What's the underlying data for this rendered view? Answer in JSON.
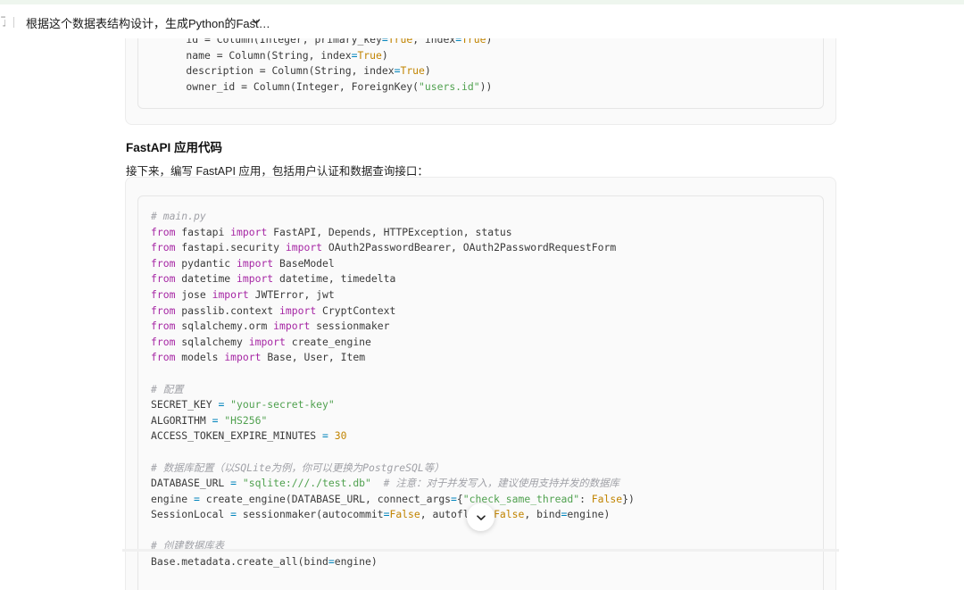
{
  "header": {
    "left_glyph": "了",
    "conversation_title": "根据这个数据表结构设计，生成Python的Fast…"
  },
  "code_block_1": {
    "lines": [
      [
        [
          "plain",
          "    id = Column(Integer, primary_key"
        ],
        [
          "op",
          "="
        ],
        [
          "bool",
          "True"
        ],
        [
          "plain",
          ", index"
        ],
        [
          "op",
          "="
        ],
        [
          "bool",
          "True"
        ],
        [
          "plain",
          ")"
        ]
      ],
      [
        [
          "plain",
          "    name = Column(String, index"
        ],
        [
          "op",
          "="
        ],
        [
          "bool",
          "True"
        ],
        [
          "plain",
          ")"
        ]
      ],
      [
        [
          "plain",
          "    description = Column(String, index"
        ],
        [
          "op",
          "="
        ],
        [
          "bool",
          "True"
        ],
        [
          "plain",
          ")"
        ]
      ],
      [
        [
          "plain",
          "    owner_id = Column(Integer, ForeignKey("
        ],
        [
          "str",
          "\"users.id\""
        ],
        [
          "plain",
          "))"
        ]
      ]
    ]
  },
  "section": {
    "heading": "FastAPI 应用代码",
    "paragraph": "接下来，编写 FastAPI 应用，包括用户认证和数据查询接口："
  },
  "code_block_2": {
    "lines": [
      [
        [
          "cm",
          "# main.py"
        ]
      ],
      [
        [
          "kw",
          "from"
        ],
        [
          "plain",
          " fastapi "
        ],
        [
          "kw",
          "import"
        ],
        [
          "plain",
          " FastAPI, Depends, HTTPException, status"
        ]
      ],
      [
        [
          "kw",
          "from"
        ],
        [
          "plain",
          " fastapi.security "
        ],
        [
          "kw",
          "import"
        ],
        [
          "plain",
          " OAuth2PasswordBearer, OAuth2PasswordRequestForm"
        ]
      ],
      [
        [
          "kw",
          "from"
        ],
        [
          "plain",
          " pydantic "
        ],
        [
          "kw",
          "import"
        ],
        [
          "plain",
          " BaseModel"
        ]
      ],
      [
        [
          "kw",
          "from"
        ],
        [
          "plain",
          " datetime "
        ],
        [
          "kw",
          "import"
        ],
        [
          "plain",
          " datetime, timedelta"
        ]
      ],
      [
        [
          "kw",
          "from"
        ],
        [
          "plain",
          " jose "
        ],
        [
          "kw",
          "import"
        ],
        [
          "plain",
          " JWTError, jwt"
        ]
      ],
      [
        [
          "kw",
          "from"
        ],
        [
          "plain",
          " passlib.context "
        ],
        [
          "kw",
          "import"
        ],
        [
          "plain",
          " CryptContext"
        ]
      ],
      [
        [
          "kw",
          "from"
        ],
        [
          "plain",
          " sqlalchemy.orm "
        ],
        [
          "kw",
          "import"
        ],
        [
          "plain",
          " sessionmaker"
        ]
      ],
      [
        [
          "kw",
          "from"
        ],
        [
          "plain",
          " sqlalchemy "
        ],
        [
          "kw",
          "import"
        ],
        [
          "plain",
          " create_engine"
        ]
      ],
      [
        [
          "kw",
          "from"
        ],
        [
          "plain",
          " models "
        ],
        [
          "kw",
          "import"
        ],
        [
          "plain",
          " Base, User, Item"
        ]
      ],
      [],
      [
        [
          "cm",
          "# 配置"
        ]
      ],
      [
        [
          "plain",
          "SECRET_KEY "
        ],
        [
          "op",
          "="
        ],
        [
          "plain",
          " "
        ],
        [
          "str",
          "\"your-secret-key\""
        ]
      ],
      [
        [
          "plain",
          "ALGORITHM "
        ],
        [
          "op",
          "="
        ],
        [
          "plain",
          " "
        ],
        [
          "str",
          "\"HS256\""
        ]
      ],
      [
        [
          "plain",
          "ACCESS_TOKEN_EXPIRE_MINUTES "
        ],
        [
          "op",
          "="
        ],
        [
          "plain",
          " "
        ],
        [
          "num",
          "30"
        ]
      ],
      [],
      [
        [
          "cm",
          "# 数据库配置（以SQLite为例，你可以更换为PostgreSQL等）"
        ]
      ],
      [
        [
          "plain",
          "DATABASE_URL "
        ],
        [
          "op",
          "="
        ],
        [
          "plain",
          " "
        ],
        [
          "str",
          "\"sqlite:///./test.db\""
        ],
        [
          "plain",
          "  "
        ],
        [
          "cm",
          "# 注意：对于并发写入，建议使用支持并发的数据库"
        ]
      ],
      [
        [
          "plain",
          "engine "
        ],
        [
          "op",
          "="
        ],
        [
          "plain",
          " create_engine(DATABASE_URL, connect_args"
        ],
        [
          "op",
          "="
        ],
        [
          "plain",
          "{"
        ],
        [
          "str",
          "\"check_same_thread\""
        ],
        [
          "plain",
          ": "
        ],
        [
          "bool",
          "False"
        ],
        [
          "plain",
          "})"
        ]
      ],
      [
        [
          "plain",
          "SessionLocal "
        ],
        [
          "op",
          "="
        ],
        [
          "plain",
          " sessionmaker(autocommit"
        ],
        [
          "op",
          "="
        ],
        [
          "bool",
          "False"
        ],
        [
          "plain",
          ", autoflush"
        ],
        [
          "op",
          "="
        ],
        [
          "bool",
          "False"
        ],
        [
          "plain",
          ", bind"
        ],
        [
          "op",
          "="
        ],
        [
          "plain",
          "engine)"
        ]
      ],
      [],
      [
        [
          "cm",
          "# 创建数据库表"
        ]
      ],
      [
        [
          "plain",
          "Base.metadata.create_all(bind"
        ],
        [
          "op",
          "="
        ],
        [
          "plain",
          "engine)"
        ]
      ]
    ]
  },
  "icons": {
    "title_dropdown": "chevron-down-icon",
    "scroll_down": "chevron-down-icon"
  }
}
